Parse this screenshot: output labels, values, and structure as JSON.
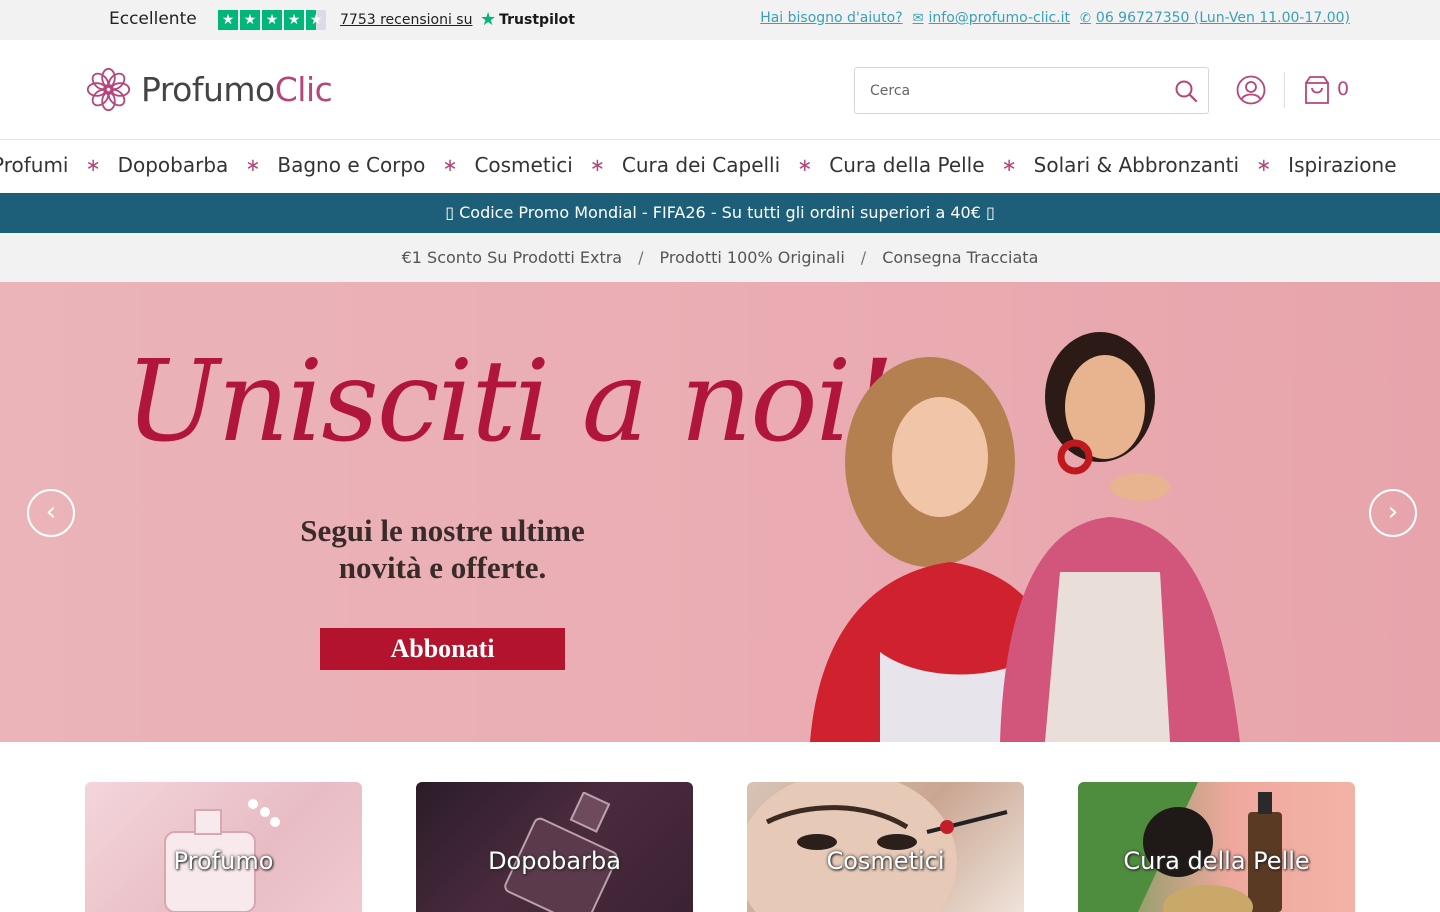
{
  "topbar": {
    "rating_label": "Eccellente",
    "review_count_text": "7753 recensioni su",
    "trustpilot_label": "Trustpilot",
    "help_label": "Hai bisogno d'aiuto?",
    "email": "info@profumo-clic.it",
    "phone": "06 96727350 (Lun-Ven 11.00-17.00)"
  },
  "header": {
    "logo_text_a": "Profumo",
    "logo_text_b": "Clic",
    "search_placeholder": "Cerca",
    "cart_count": "0"
  },
  "nav": {
    "items": [
      "Profumi",
      "Dopobarba",
      "Bagno e Corpo",
      "Cosmetici",
      "Cura dei Capelli",
      "Cura della Pelle",
      "Solari & Abbronzanti",
      "Ispirazione"
    ],
    "separator": "∗"
  },
  "promo": {
    "text": "▯ Codice Promo Mondial - FIFA26 - Su tutti gli ordini superiori a 40€ ▯"
  },
  "usp": {
    "items": [
      "€1 Sconto Su Prodotti Extra",
      "Prodotti 100% Originali",
      "Consegna Tracciata"
    ],
    "separator": "/"
  },
  "hero": {
    "title": "Unisciti a noi!",
    "subtitle": "Segui le nostre ultime novità e offerte.",
    "cta": "Abbonati",
    "prev": "‹",
    "next": "›"
  },
  "categories": [
    {
      "label": "Profumo"
    },
    {
      "label": "Dopobarba"
    },
    {
      "label": "Cosmetici"
    },
    {
      "label": "Cura della Pelle"
    }
  ],
  "colors": {
    "brand": "#b5467c",
    "promo_bg": "#1d5f79",
    "trustpilot": "#00b67a",
    "hero_cta": "#b3132c",
    "link": "#3aa0b8"
  }
}
